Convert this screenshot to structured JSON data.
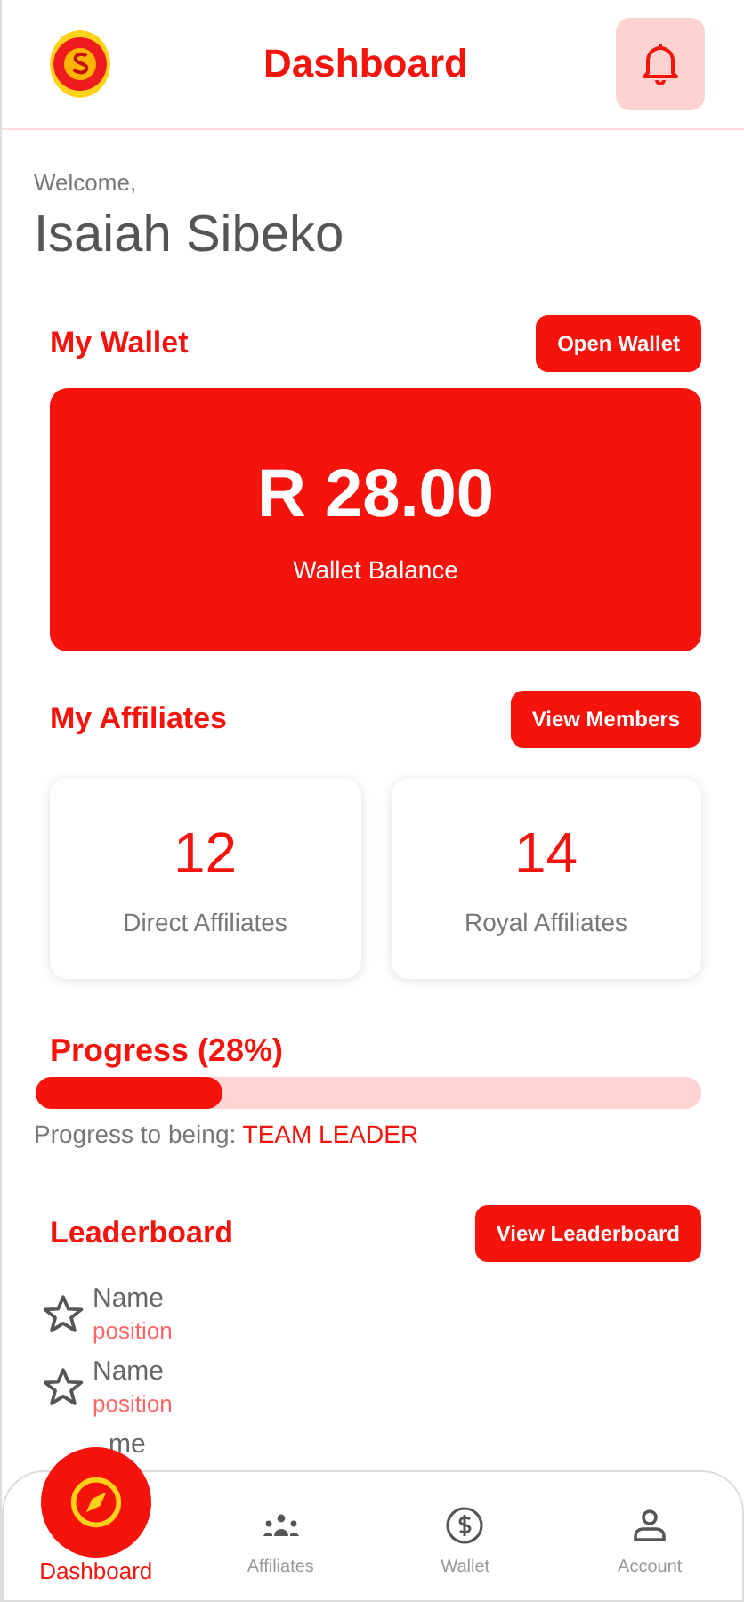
{
  "header": {
    "title": "Dashboard"
  },
  "welcome": {
    "greeting": "Welcome,",
    "name": "Isaiah Sibeko"
  },
  "wallet": {
    "title": "My Wallet",
    "button": "Open Wallet",
    "balance": "R 28.00",
    "caption": "Wallet Balance"
  },
  "affiliates": {
    "title": "My Affiliates",
    "button": "View Members",
    "cards": [
      {
        "count": "12",
        "label": "Direct Affiliates"
      },
      {
        "count": "14",
        "label": "Royal Affiliates"
      }
    ]
  },
  "progress": {
    "title": "Progress (28%)",
    "level": 0.28,
    "caption": "Progress to being:",
    "target": "TEAM LEADER"
  },
  "leaderboard": {
    "title": "Leaderboard",
    "button": "View Leaderboard",
    "entries": [
      {
        "name": "Name",
        "position": "position"
      },
      {
        "name": "Name",
        "position": "position"
      },
      {
        "name": "me"
      }
    ]
  },
  "nav": [
    {
      "label": "Dashboard",
      "kind": "compass",
      "selected": true
    },
    {
      "label": "Affiliates",
      "kind": "people",
      "selected": false
    },
    {
      "label": "Wallet",
      "kind": "coin",
      "selected": false
    },
    {
      "label": "Account",
      "kind": "person",
      "selected": false
    }
  ]
}
